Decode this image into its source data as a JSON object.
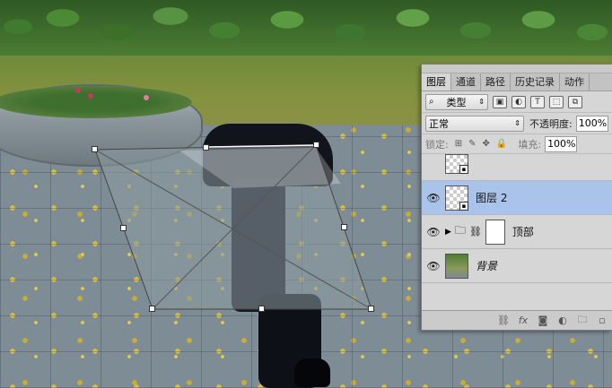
{
  "layers_panel": {
    "tabs": [
      "图层",
      "通道",
      "路径",
      "历史记录",
      "动作"
    ],
    "filter": {
      "label": "类型"
    },
    "blend_mode": "正常",
    "opacity_label": "不透明度:",
    "opacity_value": "100%",
    "lock_label": "锁定:",
    "fill_label": "填充:",
    "fill_value": "100%",
    "layers": [
      {
        "name": "",
        "selected": false,
        "visible": false
      },
      {
        "name": "图层 2",
        "selected": true,
        "visible": true
      },
      {
        "name": "顶部",
        "selected": false,
        "visible": true,
        "type": "group"
      },
      {
        "name": "背景",
        "selected": false,
        "visible": true
      }
    ]
  },
  "colors": {
    "selected_layer": "#aac3ea",
    "panel_bg": "#d6d6d6"
  }
}
